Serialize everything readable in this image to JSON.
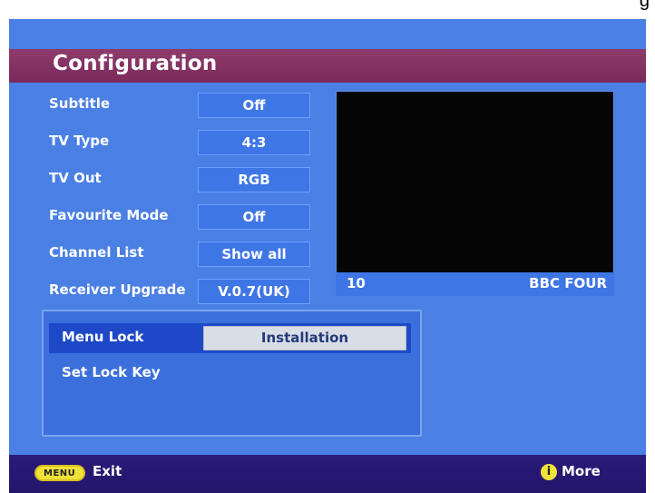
{
  "top_strip_text": "g",
  "title": "Configuration",
  "settings": [
    {
      "label": "Subtitle",
      "value": "Off"
    },
    {
      "label": "TV Type",
      "value": "4:3"
    },
    {
      "label": "TV Out",
      "value": "RGB"
    },
    {
      "label": "Favourite Mode",
      "value": "Off"
    },
    {
      "label": "Channel List",
      "value": "Show all"
    },
    {
      "label": "Receiver Upgrade",
      "value": "V.0.7(UK)"
    }
  ],
  "preview": {
    "channel_number": "10",
    "channel_name": "BBC FOUR"
  },
  "lock_panel": {
    "menu_lock_label": "Menu Lock",
    "menu_lock_value": "Installation",
    "set_lock_key_label": "Set Lock Key"
  },
  "footer": {
    "menu_key_text": "MENU",
    "exit_label": "Exit",
    "info_icon_glyph": "i",
    "more_label": "More"
  },
  "colors": {
    "background_blue": "#4a7fe4",
    "title_bar_purple": "#7a2a5b",
    "footer_navy": "#2a1a7a",
    "selection_blue": "#1d49c8",
    "key_yellow": "#f1e23a"
  }
}
